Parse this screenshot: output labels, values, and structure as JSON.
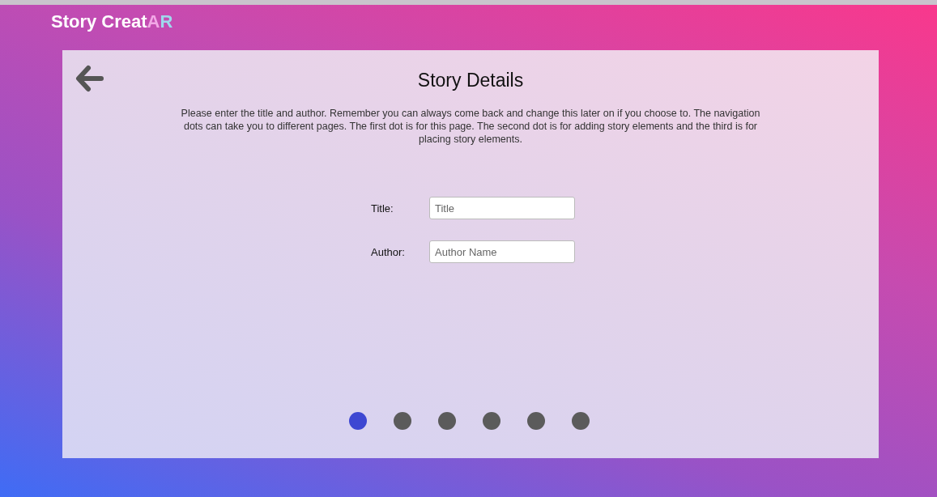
{
  "logo": {
    "parts": [
      {
        "text": "Story Creat",
        "color": "#ffffff"
      },
      {
        "text": "A",
        "color": "#f2a7e6"
      },
      {
        "text": "R",
        "color": "#9fd8ec"
      }
    ]
  },
  "card": {
    "title": "Story Details",
    "description": "Please enter the title and author. Remember you can always come back and change this later on if you choose to. The navigation dots can take you to different pages. The first dot is for this page. The second dot is for adding story elements and the third is for placing story elements.",
    "fields": [
      {
        "label": "Title:",
        "placeholder": "Title"
      },
      {
        "label": "Author:",
        "placeholder": "Author Name"
      }
    ],
    "dots": [
      {
        "selected": true
      },
      {
        "selected": false
      },
      {
        "selected": false
      },
      {
        "selected": false
      },
      {
        "selected": false
      },
      {
        "selected": false
      }
    ]
  }
}
